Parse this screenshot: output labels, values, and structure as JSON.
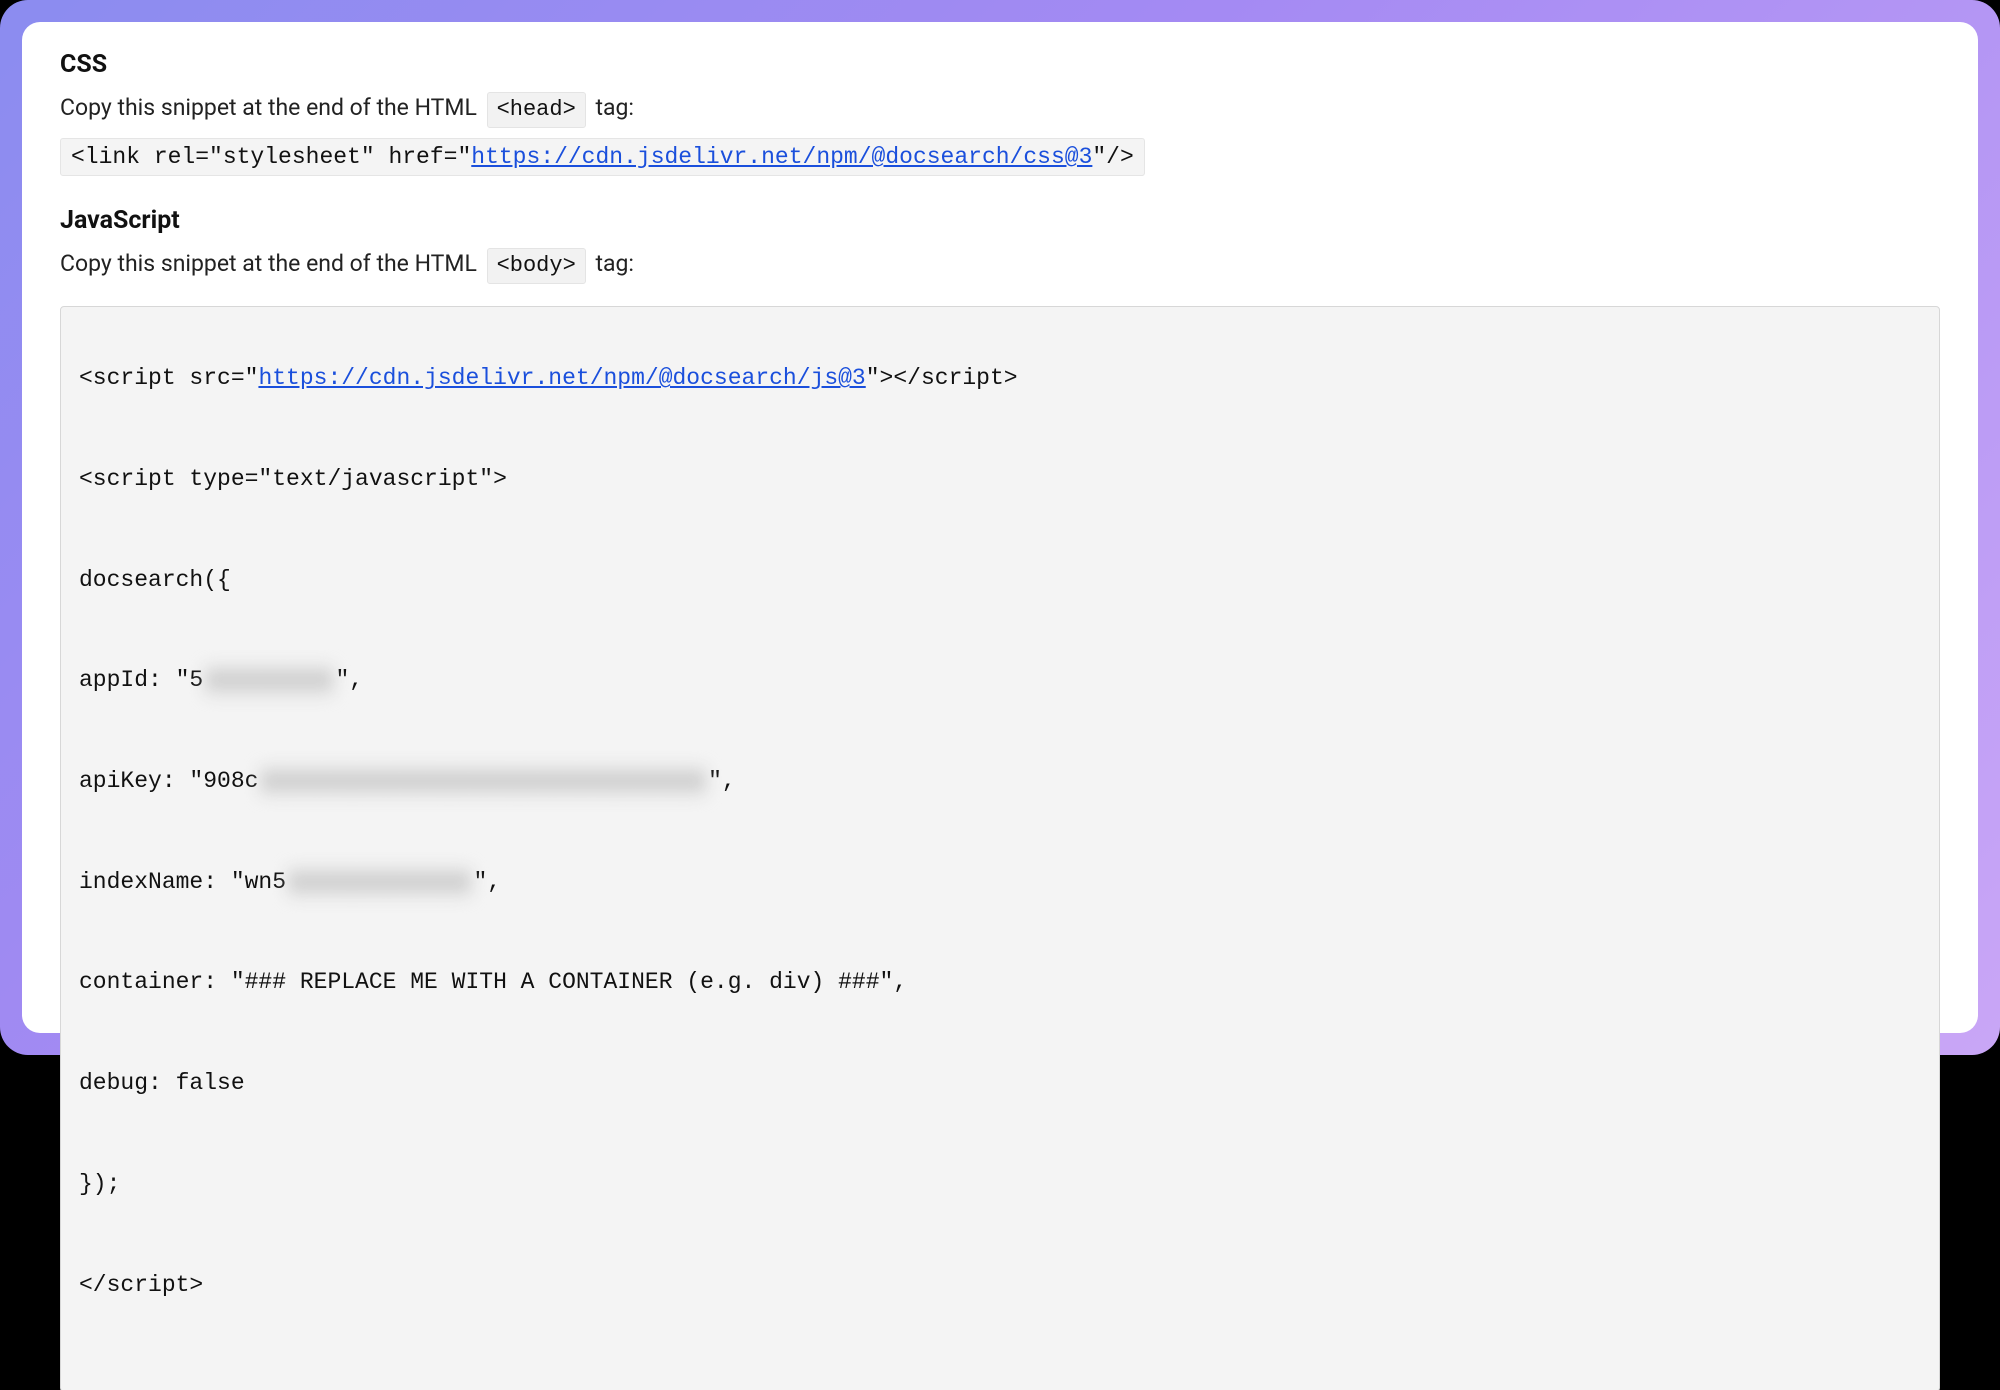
{
  "css": {
    "heading": "CSS",
    "instruction_prefix": "Copy this snippet at the end of the HTML",
    "tag_label": "<head>",
    "instruction_suffix": " tag:",
    "snippet_prefix": "<link rel=\"stylesheet\" href=\"",
    "snippet_link": "https://cdn.jsdelivr.net/npm/@docsearch/css@3",
    "snippet_suffix": "\"/>"
  },
  "js": {
    "heading": "JavaScript",
    "instruction_prefix": "Copy this snippet at the end of the HTML",
    "tag_label": "<body>",
    "instruction_suffix": " tag:",
    "code": {
      "line1_prefix": "<script src=\"",
      "line1_link": "https://cdn.jsdelivr.net/npm/@docsearch/js@3",
      "line1_suffix": "\"></script>",
      "line2": "<script type=\"text/javascript\">",
      "line3": "docsearch({",
      "appid_prefix": "appId: \"5",
      "appid_blur": "xxxxxxxxx",
      "appid_suffix": "\",",
      "apikey_prefix": "apiKey: \"908c",
      "apikey_blur": "xxxxxxxxxxxxxxxxxxxxxxxxxxxxxxxx",
      "apikey_suffix": "\",",
      "indexname_prefix": "indexName: \"wn5",
      "indexname_blur": "xxxxxxxxxxxxx",
      "indexname_suffix": "\",",
      "container": "container: \"### REPLACE ME WITH A CONTAINER (e.g. div) ###\",",
      "debug": "debug: false",
      "close_obj": "});",
      "close_script": "</script>"
    }
  }
}
